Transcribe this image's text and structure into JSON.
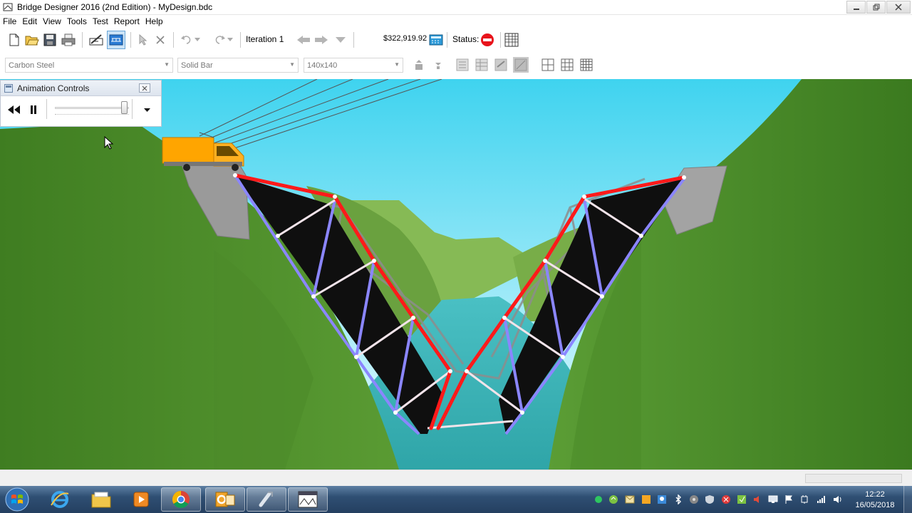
{
  "window": {
    "title": "Bridge Designer 2016 (2nd Edition) - MyDesign.bdc",
    "controls": [
      "minimize",
      "maximize",
      "close"
    ]
  },
  "menu": [
    "File",
    "Edit",
    "View",
    "Tools",
    "Test",
    "Report",
    "Help"
  ],
  "toolbar": {
    "iteration_label": "Iteration 1",
    "cost": "$322,919.92",
    "status_label": "Status:",
    "status_icon": "stop-icon"
  },
  "member_props": {
    "material": "Carbon Steel",
    "cross_section": "Solid Bar",
    "size": "140x140"
  },
  "animation_controls": {
    "title": "Animation Controls",
    "speed_level": 0.9
  },
  "taskbar": {
    "apps": [
      "windows-start",
      "internet-explorer",
      "file-explorer",
      "media-player",
      "chrome",
      "outlook",
      "bridge-designer-launcher",
      "bridge-designer-window"
    ],
    "time": "12:22",
    "date": "16/05/2018"
  },
  "colors": {
    "compression_member": "#ff1a1a",
    "tension_member": "#8080ff",
    "truck": "#ffa500",
    "sky_top": "#44d9f0",
    "river": "#3cb6b8",
    "canyon_green": "#4c8c2c"
  }
}
